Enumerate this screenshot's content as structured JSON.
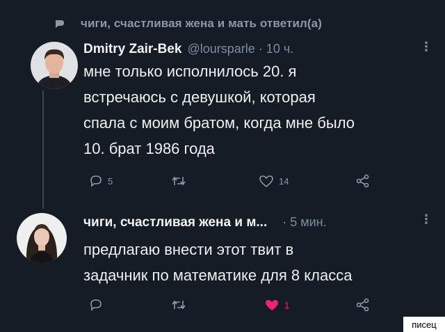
{
  "context": {
    "icon": "reply-arrow-icon",
    "text": "чиги, счастливая жена и мать ответил(а)"
  },
  "tweet1": {
    "author_name": "Dmitry Zair-Bek",
    "meta": "@loursparle · 10 ч.",
    "lines": [
      "мне только исполнилось 20. я",
      "встречаюсь с девушкой, которая",
      "спала с моим братом, когда мне было",
      "10. брат 1986 года"
    ],
    "replies": "5",
    "retweets": "",
    "likes": "14"
  },
  "tweet2": {
    "author_name": "чиги, счастливая жена и м...",
    "meta": "· 5 мин.",
    "lines": [
      "предлагаю внести этот твит в",
      "задачник по математике для 8 класса"
    ],
    "replies": "",
    "retweets": "",
    "likes": "1"
  },
  "more_glyph": "⋮",
  "watermark": "писец",
  "colors": {
    "background": "#151c26",
    "like_active": "#f0246d",
    "muted": "#8b98a5"
  }
}
